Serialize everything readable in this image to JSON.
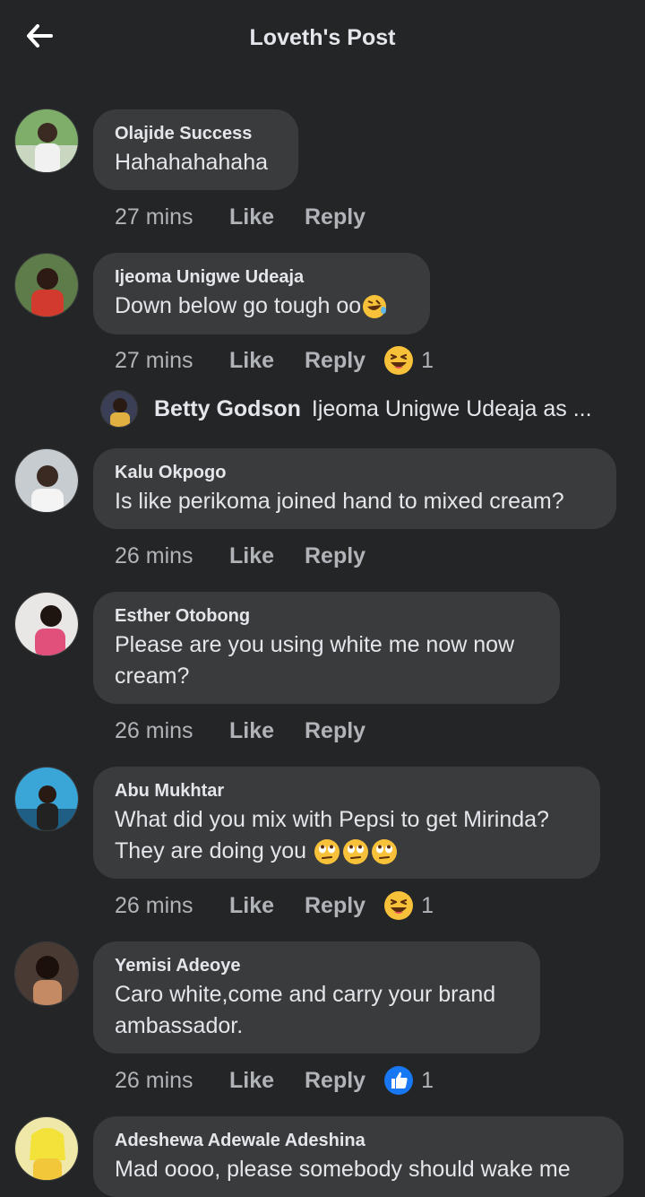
{
  "header": {
    "title": "Loveth's Post",
    "back_icon": "arrow-left-icon"
  },
  "colors": {
    "background": "#242526",
    "bubble": "#3a3b3c",
    "text": "#e4e6eb",
    "muted": "#b0b3b8",
    "like_blue": "#1877f2",
    "emoji_yellow": "#f7c23a"
  },
  "comments": [
    {
      "author": "Olajide Success",
      "text": "Hahahahahaha",
      "time": "27 mins",
      "like": "Like",
      "reply": "Reply"
    },
    {
      "author": "Ijeoma Unigwe Udeaja",
      "text": "Down below go tough oo",
      "time": "27 mins",
      "like": "Like",
      "reply": "Reply",
      "reaction": {
        "type": "haha",
        "count": "1"
      }
    },
    {
      "author": "Kalu Okpogo",
      "text": "Is like perikoma joined hand to mixed cream?",
      "time": "26 mins",
      "like": "Like",
      "reply": "Reply"
    },
    {
      "author": "Esther Otobong",
      "text_lines": [
        "Please are you using white me now now",
        "cream?"
      ],
      "time": "26 mins",
      "like": "Like",
      "reply": "Reply"
    },
    {
      "author": "Abu Mukhtar",
      "text_lines": [
        "What did you mix with Pepsi to get Mirinda?",
        "They are doing you"
      ],
      "time": "26 mins",
      "like": "Like",
      "reply": "Reply",
      "reaction": {
        "type": "haha",
        "count": "1"
      }
    },
    {
      "author": "Yemisi Adeoye",
      "text_lines": [
        "Caro white,come and carry your brand",
        "ambassador."
      ],
      "time": "26 mins",
      "like": "Like",
      "reply": "Reply",
      "reaction": {
        "type": "like",
        "count": "1"
      }
    },
    {
      "author": "Adeshewa Adewale Adeshina",
      "text": "Mad oooo, please somebody should wake me"
    }
  ],
  "reply_preview": {
    "name": "Betty Godson",
    "text": "Ijeoma Unigwe Udeaja as ..."
  }
}
